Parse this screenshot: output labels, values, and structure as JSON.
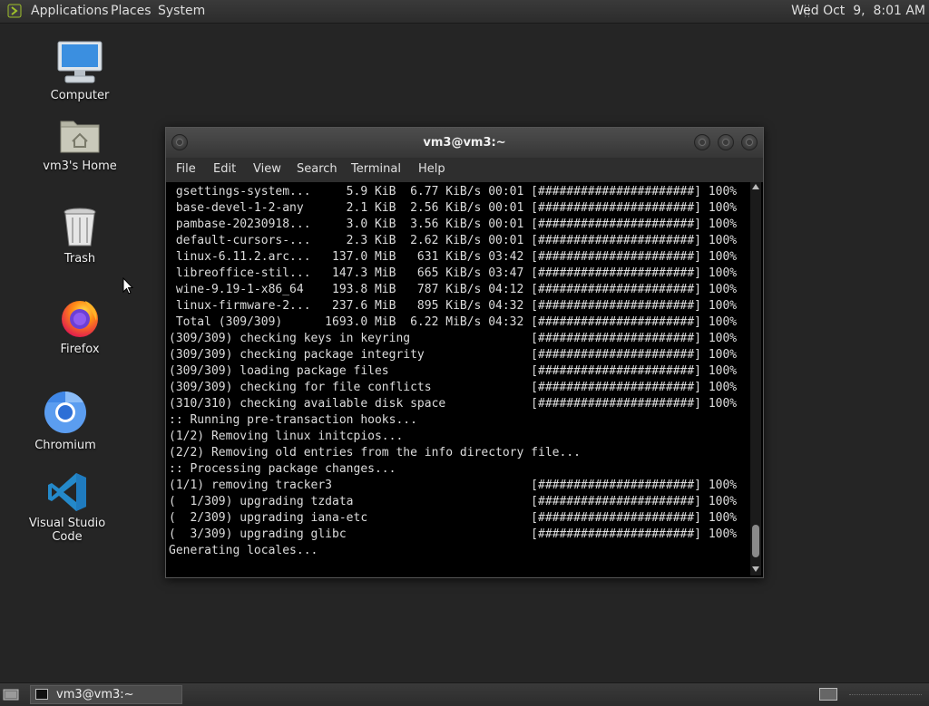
{
  "top_panel": {
    "menus": [
      "Applications",
      "Places",
      "System"
    ],
    "clock": "Wed Oct  9,  8:01 AM"
  },
  "desktop": {
    "icons": [
      {
        "label": "Computer",
        "icon": "computer-icon"
      },
      {
        "label": "vm3's Home",
        "icon": "home-folder-icon"
      },
      {
        "label": "Trash",
        "icon": "trash-icon"
      },
      {
        "label": "Firefox",
        "icon": "firefox-icon"
      },
      {
        "label": "Chromium",
        "icon": "chromium-icon"
      },
      {
        "label": "Visual Studio Code",
        "icon": "vscode-icon"
      }
    ]
  },
  "terminal": {
    "title": "vm3@vm3:~",
    "menu": [
      "File",
      "Edit",
      "View",
      "Search",
      "Terminal",
      "Help"
    ],
    "lines": [
      " gsettings-system...     5.9 KiB  6.77 KiB/s 00:01 [######################] 100%",
      " base-devel-1-2-any      2.1 KiB  2.56 KiB/s 00:01 [######################] 100%",
      " pambase-20230918...     3.0 KiB  3.56 KiB/s 00:01 [######################] 100%",
      " default-cursors-...     2.3 KiB  2.62 KiB/s 00:01 [######################] 100%",
      " linux-6.11.2.arc...   137.0 MiB   631 KiB/s 03:42 [######################] 100%",
      " libreoffice-stil...   147.3 MiB   665 KiB/s 03:47 [######################] 100%",
      " wine-9.19-1-x86_64    193.8 MiB   787 KiB/s 04:12 [######################] 100%",
      " linux-firmware-2...   237.6 MiB   895 KiB/s 04:32 [######################] 100%",
      " Total (309/309)      1693.0 MiB  6.22 MiB/s 04:32 [######################] 100%",
      "(309/309) checking keys in keyring                 [######################] 100%",
      "(309/309) checking package integrity               [######################] 100%",
      "(309/309) loading package files                    [######################] 100%",
      "(309/309) checking for file conflicts              [######################] 100%",
      "(310/310) checking available disk space            [######################] 100%",
      ":: Running pre-transaction hooks...",
      "(1/2) Removing linux initcpios...",
      "(2/2) Removing old entries from the info directory file...",
      ":: Processing package changes...",
      "(1/1) removing tracker3                            [######################] 100%",
      "(  1/309) upgrading tzdata                         [######################] 100%",
      "(  2/309) upgrading iana-etc                       [######################] 100%",
      "(  3/309) upgrading glibc                          [######################] 100%",
      "Generating locales..."
    ]
  },
  "taskbar": {
    "task_label": "vm3@vm3:~"
  }
}
